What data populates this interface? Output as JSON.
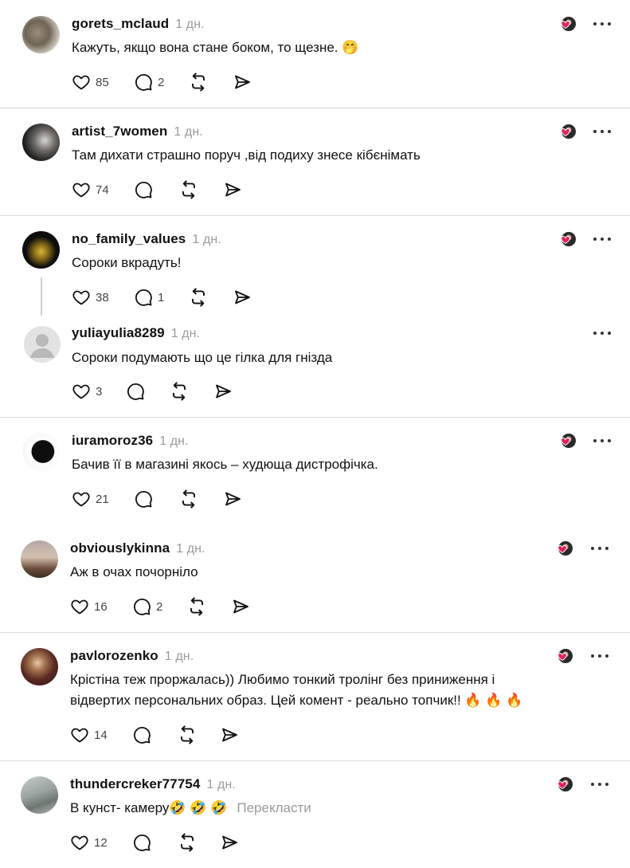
{
  "comments": [
    {
      "username": "gorets_mclaud",
      "time": "1 дн.",
      "text": "Кажуть, якщо вона стане боком, то щезне. 🤭",
      "likes": "85",
      "replies": "2"
    },
    {
      "username": "artist_7women",
      "time": "1 дн.",
      "text": "Там дихати страшно поруч ,від подиху знесе кібєнімать",
      "likes": "74",
      "replies": ""
    },
    {
      "username": "no_family_values",
      "time": "1 дн.",
      "text": "Сороки вкрадуть!",
      "likes": "38",
      "replies": "1"
    },
    {
      "username": "yuliayulia8289",
      "time": "1 дн.",
      "text": "Сороки подумають що це гілка для гнізда",
      "likes": "3",
      "replies": ""
    },
    {
      "username": "iuramoroz36",
      "time": "1 дн.",
      "text": "Бачив її в магазині якось – худюща дистрофічка.",
      "likes": "21",
      "replies": ""
    },
    {
      "username": "obviouslykinna",
      "time": "1 дн.",
      "text": "Аж в очах почорніло",
      "likes": "16",
      "replies": "2"
    },
    {
      "username": "pavlorozenko",
      "time": "1 дн.",
      "text_line1": "Крістіна теж проржалась)) Любимо тонкий тролінг без приниження і",
      "text_line2": "відвертих персональних образ. Цей комент - реально топчик!! 🔥 🔥 🔥",
      "likes": "14",
      "replies": ""
    },
    {
      "username": "thundercreker77754",
      "time": "1 дн.",
      "text": "В кунст- камеру🤣 🤣 🤣",
      "translate": "Перекласти",
      "likes": "12",
      "replies": ""
    }
  ],
  "colors": {
    "heart": "#e0245e",
    "text": "#101010",
    "muted": "#9a9a9a",
    "divider": "#dcdcdc"
  }
}
